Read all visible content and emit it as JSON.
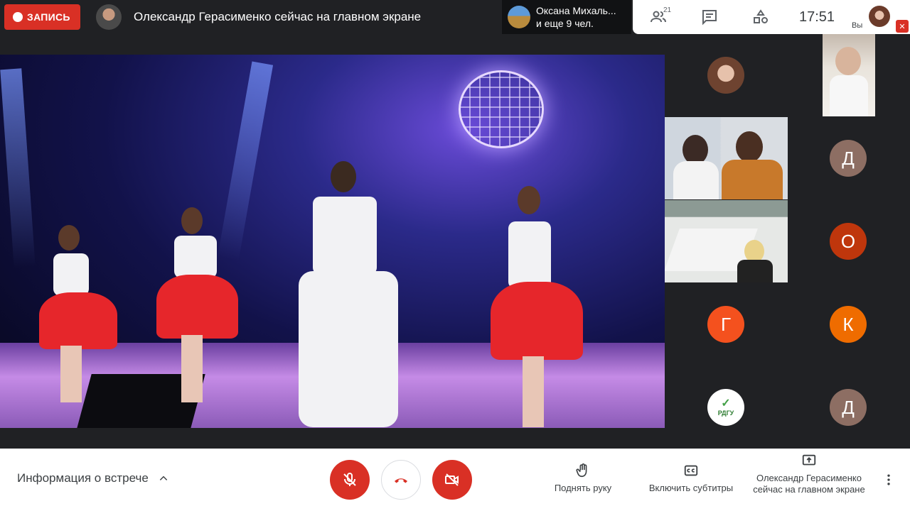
{
  "top": {
    "record_label": "ЗАПИСЬ",
    "presenter_title": "Олександр Герасименко сейчас на главном экране",
    "viewers_line1": "Оксана Михаль...",
    "viewers_line2": "и еще 9 чел.",
    "people_count": "21",
    "clock": "17:51",
    "self_label": "Вы"
  },
  "participants": [
    {
      "initial": "Д",
      "color": "#8d6e63"
    },
    {
      "initial": "О",
      "color": "#bf360c"
    },
    {
      "initial": "Г",
      "color": "#f4511e"
    },
    {
      "initial": "К",
      "color": "#ef6c00"
    },
    {
      "initial": "Д",
      "color": "#8d6e63"
    },
    {
      "logo_text": "РДГУ"
    }
  ],
  "bottom": {
    "meeting_info_label": "Информация о встрече",
    "raise_hand_label": "Поднять руку",
    "captions_label": "Включить субтитры",
    "presenting_label": "Олександр Герасименко сейчас на главном экране"
  },
  "icons": {
    "record": "record-dot-icon",
    "people": "people-icon",
    "chat": "chat-icon",
    "activities": "activities-icon",
    "mic_off": "mic-off-icon",
    "hang_up": "hang-up-icon",
    "camera_off": "camera-off-icon",
    "hand": "raise-hand-icon",
    "captions": "captions-icon",
    "present": "present-screen-icon",
    "more": "more-vert-icon"
  },
  "colors": {
    "accent_red": "#d93025",
    "dark_bg": "#202124"
  }
}
